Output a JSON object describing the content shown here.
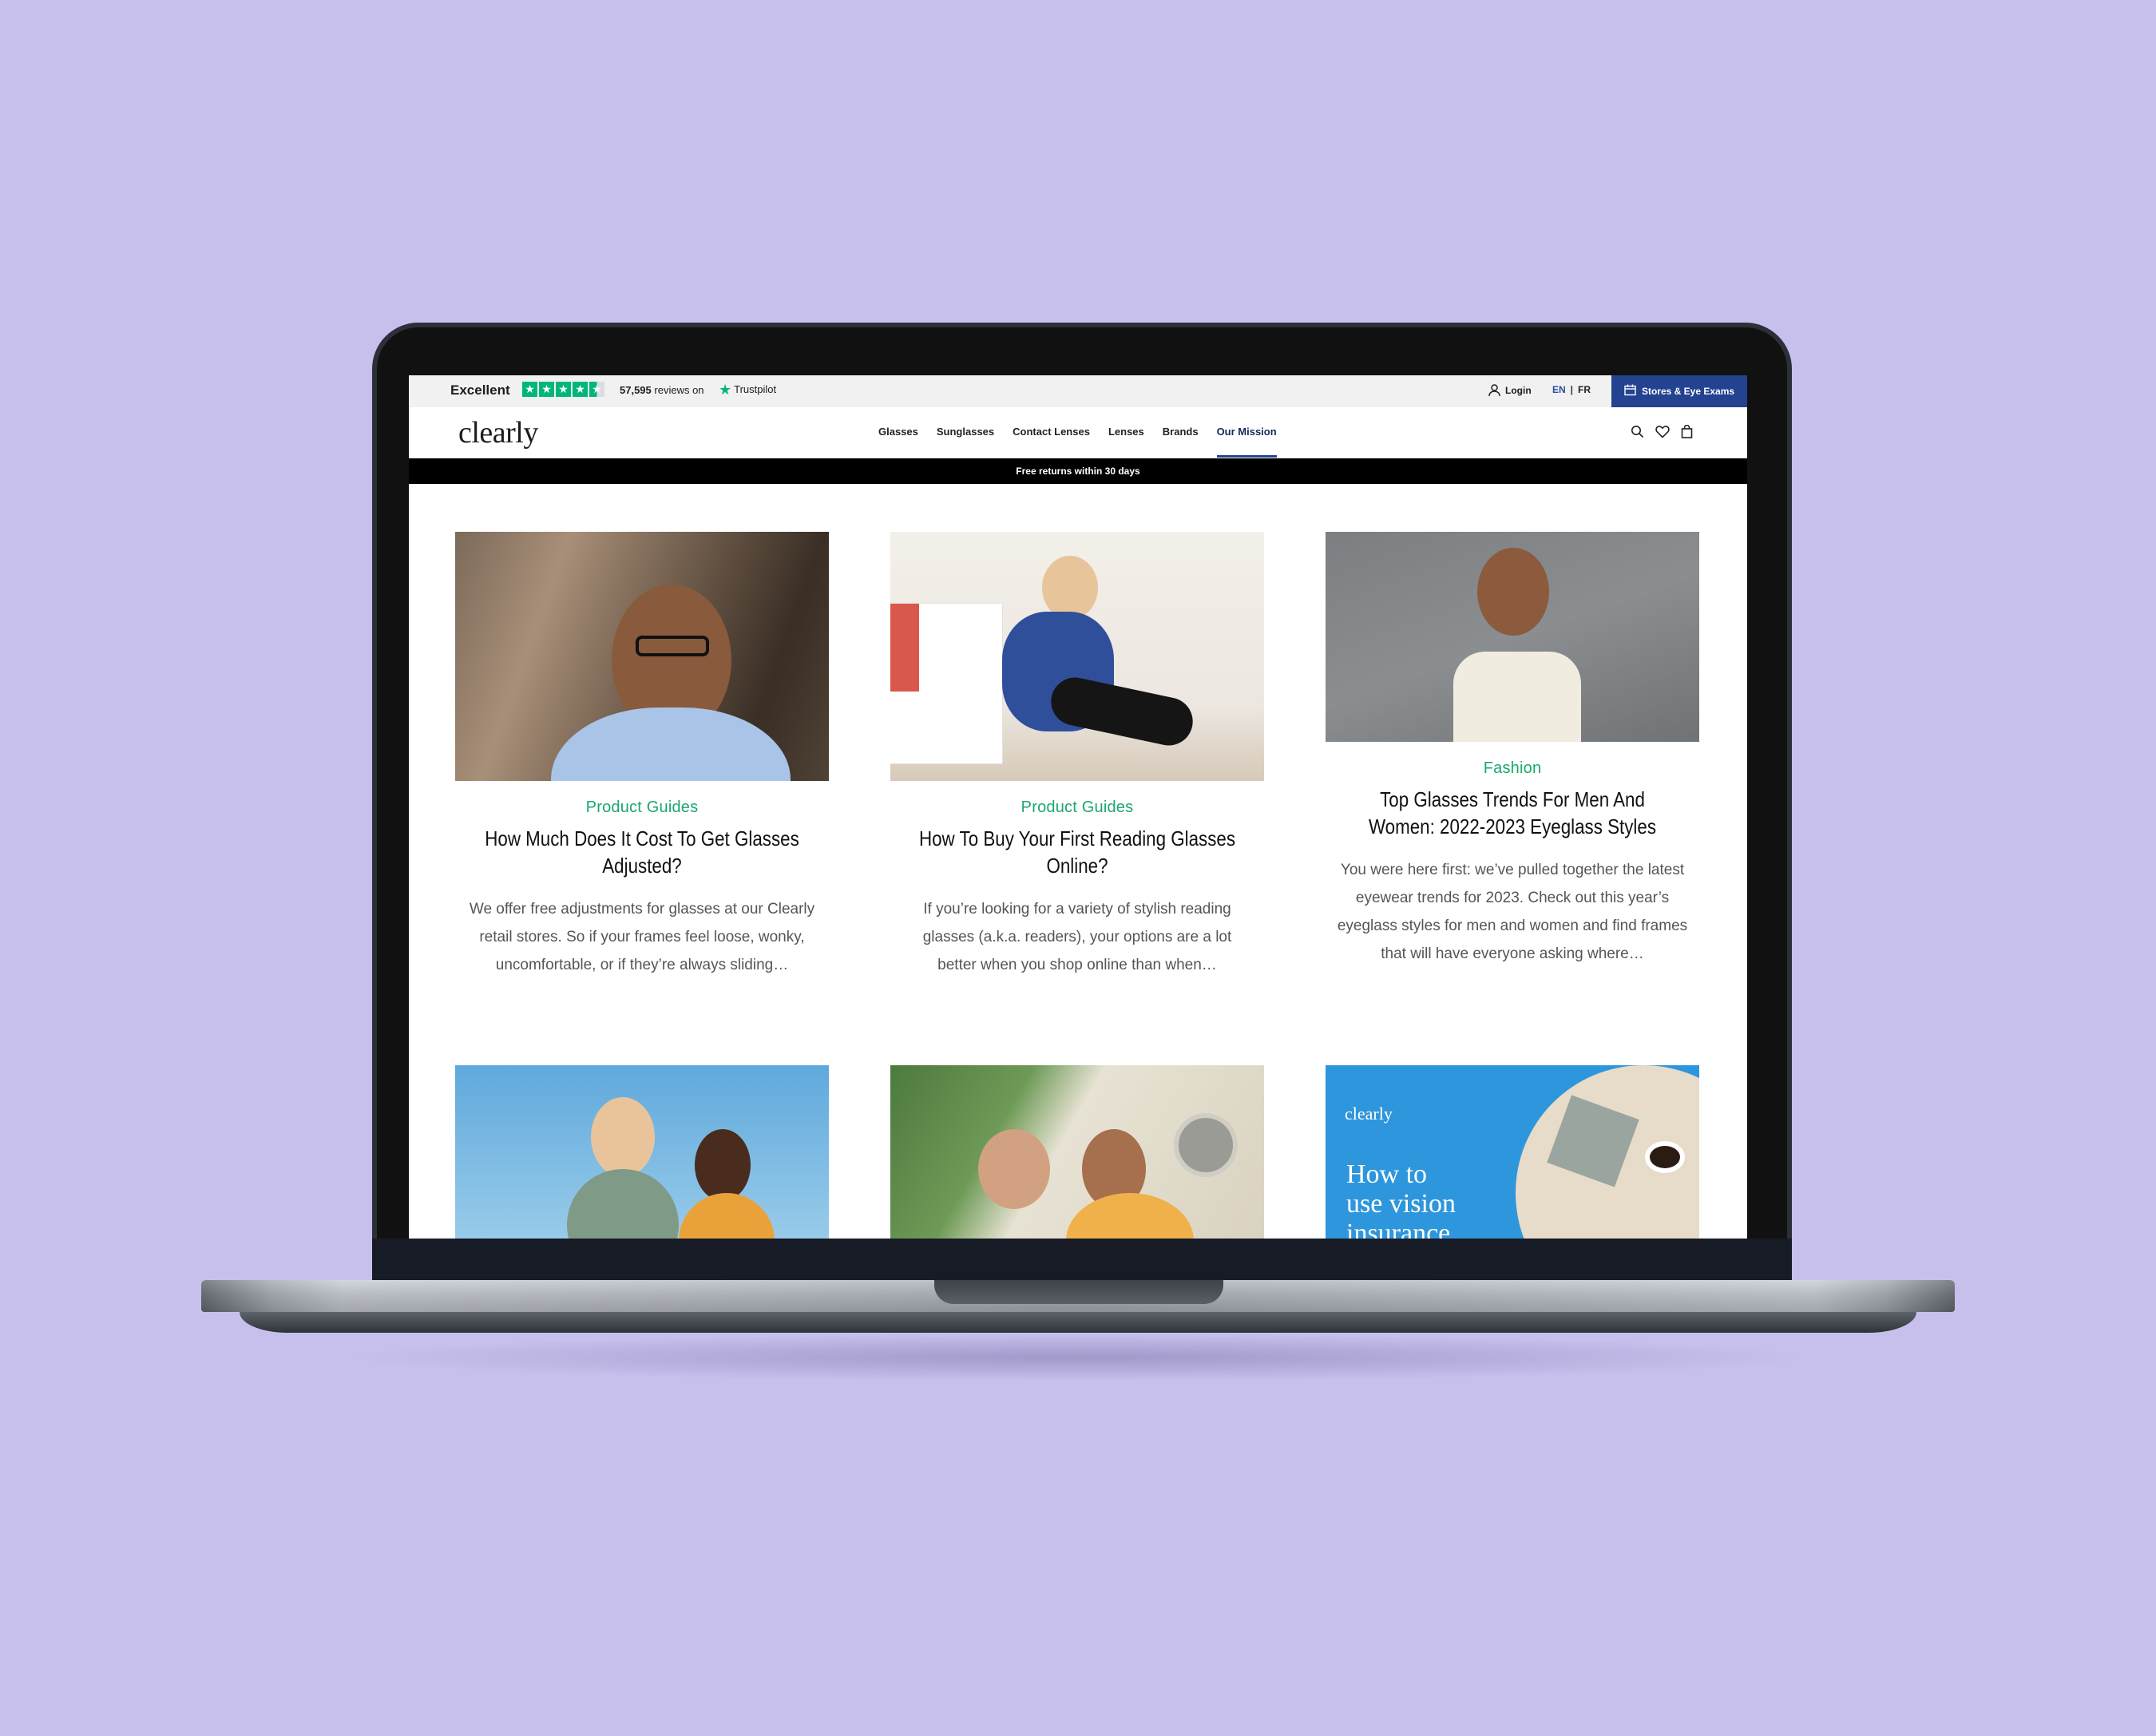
{
  "topbar": {
    "rating_word": "Excellent",
    "reviews_count": "57,595",
    "reviews_suffix": "reviews on",
    "trustpilot": "Trustpilot",
    "login": "Login",
    "lang_en": "EN",
    "lang_sep": "|",
    "lang_fr": "FR",
    "stores_button": "Stores & Eye Exams",
    "accent_color": "#234290",
    "rating_color": "#00b67a"
  },
  "nav": {
    "logo": "clearly",
    "links": [
      "Glasses",
      "Sunglasses",
      "Contact Lenses",
      "Lenses",
      "Brands",
      "Our Mission"
    ],
    "active": "Our Mission"
  },
  "banner": {
    "text": "Free returns within 30 days"
  },
  "articles": [
    {
      "category": "Product Guides",
      "title": "How Much Does It Cost To Get Glasses Adjusted?",
      "excerpt": "We offer free adjustments for glasses at our Clearly retail stores. So if your frames feel loose, wonky, uncomfortable, or if they’re always sliding…"
    },
    {
      "category": "Product Guides",
      "title": "How To Buy Your First Reading Glasses Online?",
      "excerpt": "If you’re looking for a variety of stylish reading glasses (a.k.a. readers), your options are a lot better when you shop online than when…"
    },
    {
      "category": "Fashion",
      "title": "Top Glasses Trends For Men And Women: 2022-2023 Eyeglass Styles",
      "excerpt": "You were here first: we’ve pulled together the latest eyewear trends for 2023. Check out this year’s eyeglass styles for men and women and find frames that will have everyone asking where…"
    }
  ],
  "promo_card": {
    "logo": "clearly",
    "headline_line1": "How to",
    "headline_line2": "use vision",
    "headline_line3": "insurance"
  },
  "category_color": "#1aa86d"
}
